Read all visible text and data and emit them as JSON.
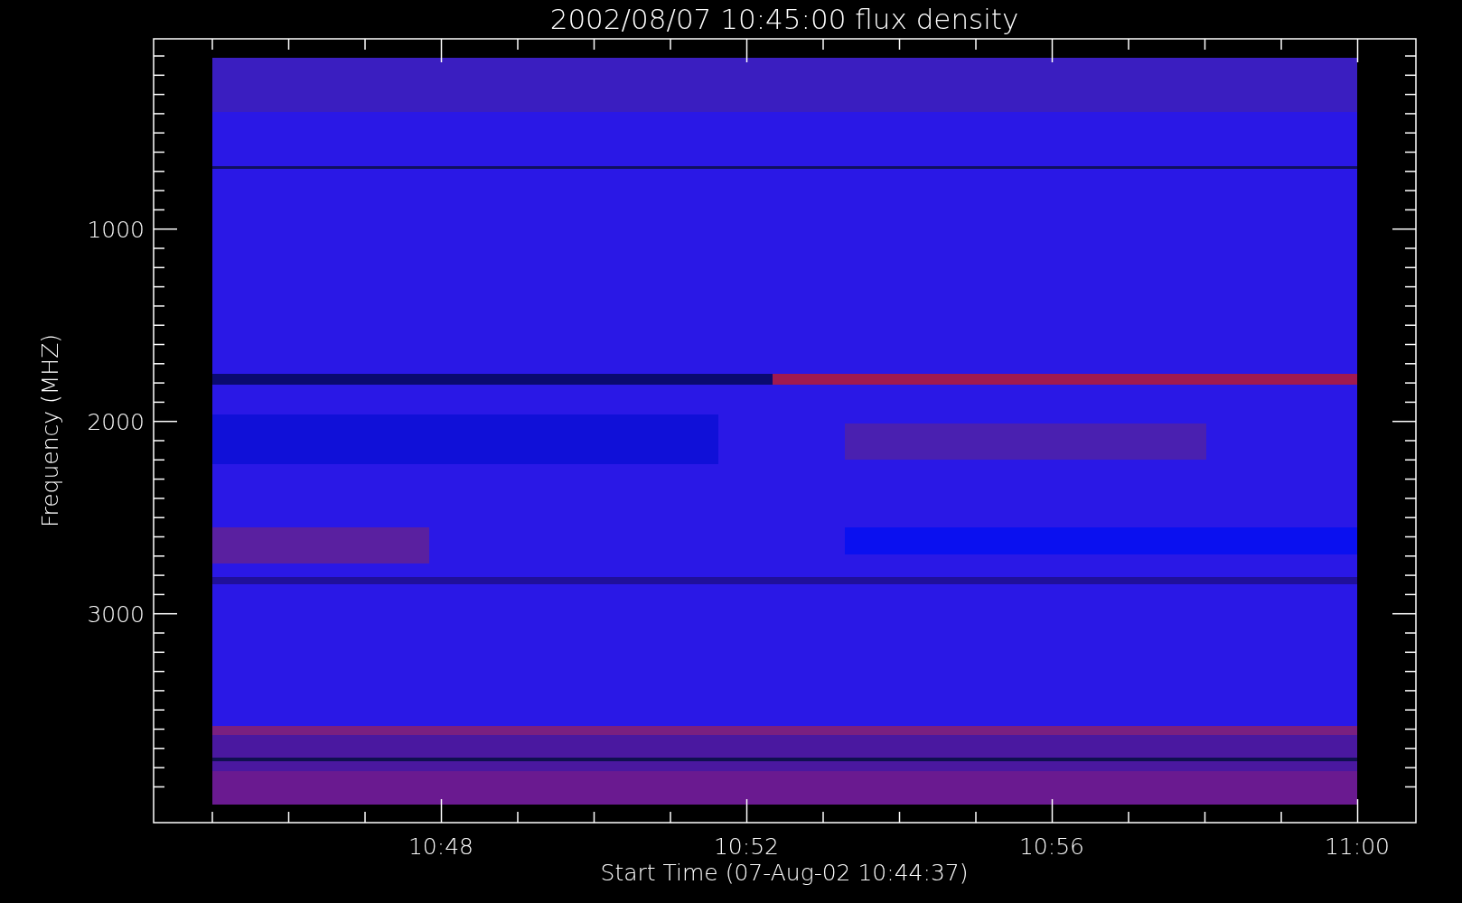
{
  "title": "2002/08/07 10:45:00 flux density",
  "y_axis": {
    "label": "Frequency (MHZ)",
    "ticks": [
      "1000",
      "2000",
      "3000"
    ]
  },
  "x_axis": {
    "label": "Start Time (07-Aug-02 10:44:37)",
    "ticks": [
      "10:48",
      "10:52",
      "10:56",
      "11:00"
    ]
  }
}
